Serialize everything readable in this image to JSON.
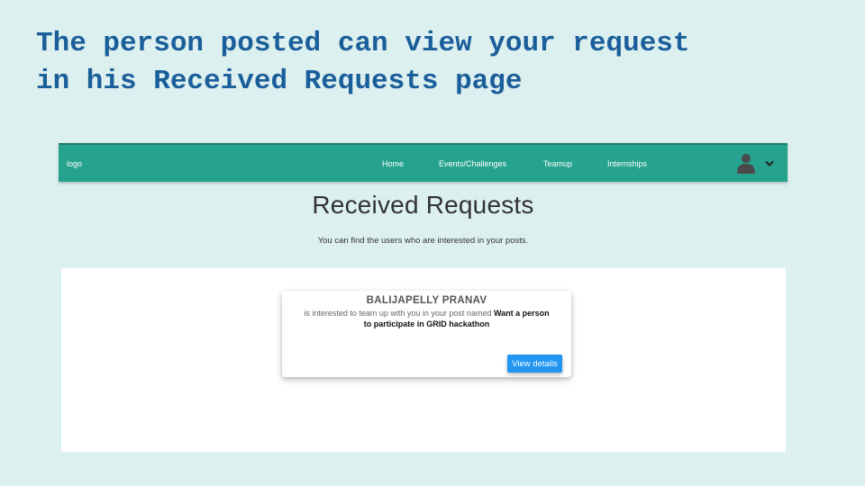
{
  "slide": {
    "title_line1": "The person posted can view your request",
    "title_line2": "in his Received Requests page"
  },
  "navbar": {
    "logo": "logo",
    "links": {
      "home": "Home",
      "events": "Events/Challenges",
      "teamup": "Teamup",
      "internships": "Internships"
    },
    "avatar_icon": "user-icon",
    "dropdown_icon": "chevron-down-icon",
    "color": "#26a38f"
  },
  "page": {
    "title": "Received Requests",
    "subtitle": "You can find the users who are interested in your posts."
  },
  "requests": [
    {
      "user_name": "BALIJAPELLY PRANAV",
      "message": "is interested to team up with you in your post named",
      "post_name": "Want a person to participate in GRID hackathon",
      "button_label": "View details",
      "button_color": "#2196f3"
    }
  ]
}
